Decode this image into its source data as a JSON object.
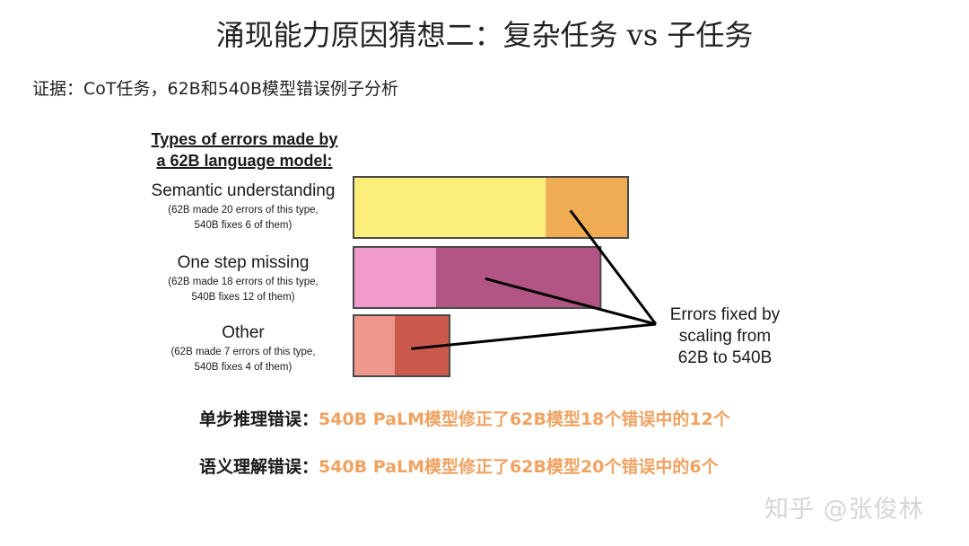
{
  "title": "涌现能力原因猜想二：复杂任务 vs 子任务",
  "subtitle": "证据：CoT任务，62B和540B模型错误例子分析",
  "chart_data": {
    "type": "bar",
    "orientation": "horizontal",
    "stacked": true,
    "title_line1": "Types of errors made by",
    "title_line2": "a 62B language model:",
    "categories": [
      {
        "name": "Semantic understanding",
        "note1": "(62B made 20 errors of this type,",
        "note2": "540B fixes 6 of them)"
      },
      {
        "name": "One step missing",
        "note1": "(62B made 18 errors of this type,",
        "note2": "540B fixes 12 of them)"
      },
      {
        "name": "Other",
        "note1": "(62B made 7 errors of this type,",
        "note2": "540B fixes 4 of them)"
      }
    ],
    "series": [
      {
        "values": [
          14,
          6,
          3
        ]
      },
      {
        "values": [
          6,
          12,
          4
        ]
      }
    ],
    "totals": [
      20,
      18,
      7
    ],
    "colors": {
      "unfixed": [
        "#fbee7a",
        "#f19ccd",
        "#ef978a"
      ],
      "fixed": [
        "#efac52",
        "#b35584",
        "#cc5a4c"
      ]
    },
    "annotation_line1": "Errors fixed by",
    "annotation_line2": "scaling from",
    "annotation_line3": "62B to 540B"
  },
  "conclusions": [
    {
      "label": "单步推理错误：",
      "value": "540B PaLM模型修正了62B模型18个错误中的12个"
    },
    {
      "label": "语义理解错误：",
      "value": "540B PaLM模型修正了62B模型20个错误中的6个"
    }
  ],
  "watermark": "知乎 @张俊林"
}
